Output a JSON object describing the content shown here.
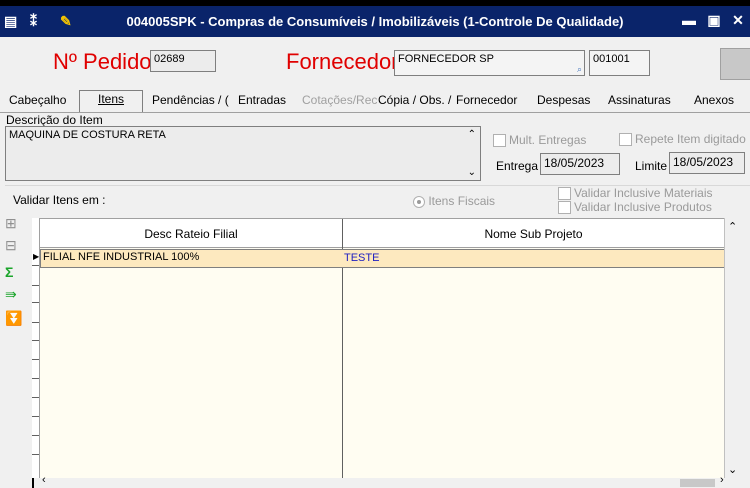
{
  "window": {
    "title": "004005SPK - Compras de Consumíveis / Imobilizáveis (1-Controle De Qualidade)",
    "min_icon": "minimize-icon",
    "max_icon": "maximize-icon",
    "close_icon": "close-icon"
  },
  "header": {
    "pedido_label": "Nº Pedido",
    "pedido_value": "02689",
    "fornecedor_label": "Fornecedor",
    "fornecedor_value": "FORNECEDOR SP",
    "fornecedor_code": "001001"
  },
  "tabs": [
    {
      "label": "Cabeçalho",
      "state": "normal"
    },
    {
      "label": "Itens",
      "state": "active"
    },
    {
      "label": "Pendências / (",
      "state": "normal"
    },
    {
      "label": "Entradas",
      "state": "normal"
    },
    {
      "label": "Cotações/Rec",
      "state": "disabled"
    },
    {
      "label": "Cópia / Obs. /",
      "state": "normal"
    },
    {
      "label": "Fornecedor",
      "state": "normal"
    },
    {
      "label": "Despesas",
      "state": "normal"
    },
    {
      "label": "Assinaturas",
      "state": "normal"
    },
    {
      "label": "Anexos",
      "state": "normal"
    }
  ],
  "item": {
    "descricao_label": "Descrição do Item",
    "descricao_value": "MAQUINA DE COSTURA RETA",
    "mult_entregas": "Mult. Entregas",
    "repete_item": "Repete Item digitado",
    "entrega_label": "Entrega",
    "entrega_value": "18/05/2023",
    "limite_label": "Limite",
    "limite_value": "18/05/2023"
  },
  "validar": {
    "label": "Validar Itens em :",
    "itens_fiscais": "Itens Fiscais",
    "inclusive_materiais": "Validar Inclusive Materiais",
    "inclusive_produtos": "Validar Inclusive Produtos"
  },
  "grid": {
    "columns": [
      "Desc Rateio Filial",
      "Nome Sub Projeto"
    ],
    "rows": [
      [
        "FILIAL NFE INDUSTRIAL 100%",
        "TESTE"
      ]
    ]
  },
  "colors": {
    "title_bg": "#0a246a",
    "red_label": "#e00000",
    "selected_row": "#fde9bf"
  }
}
